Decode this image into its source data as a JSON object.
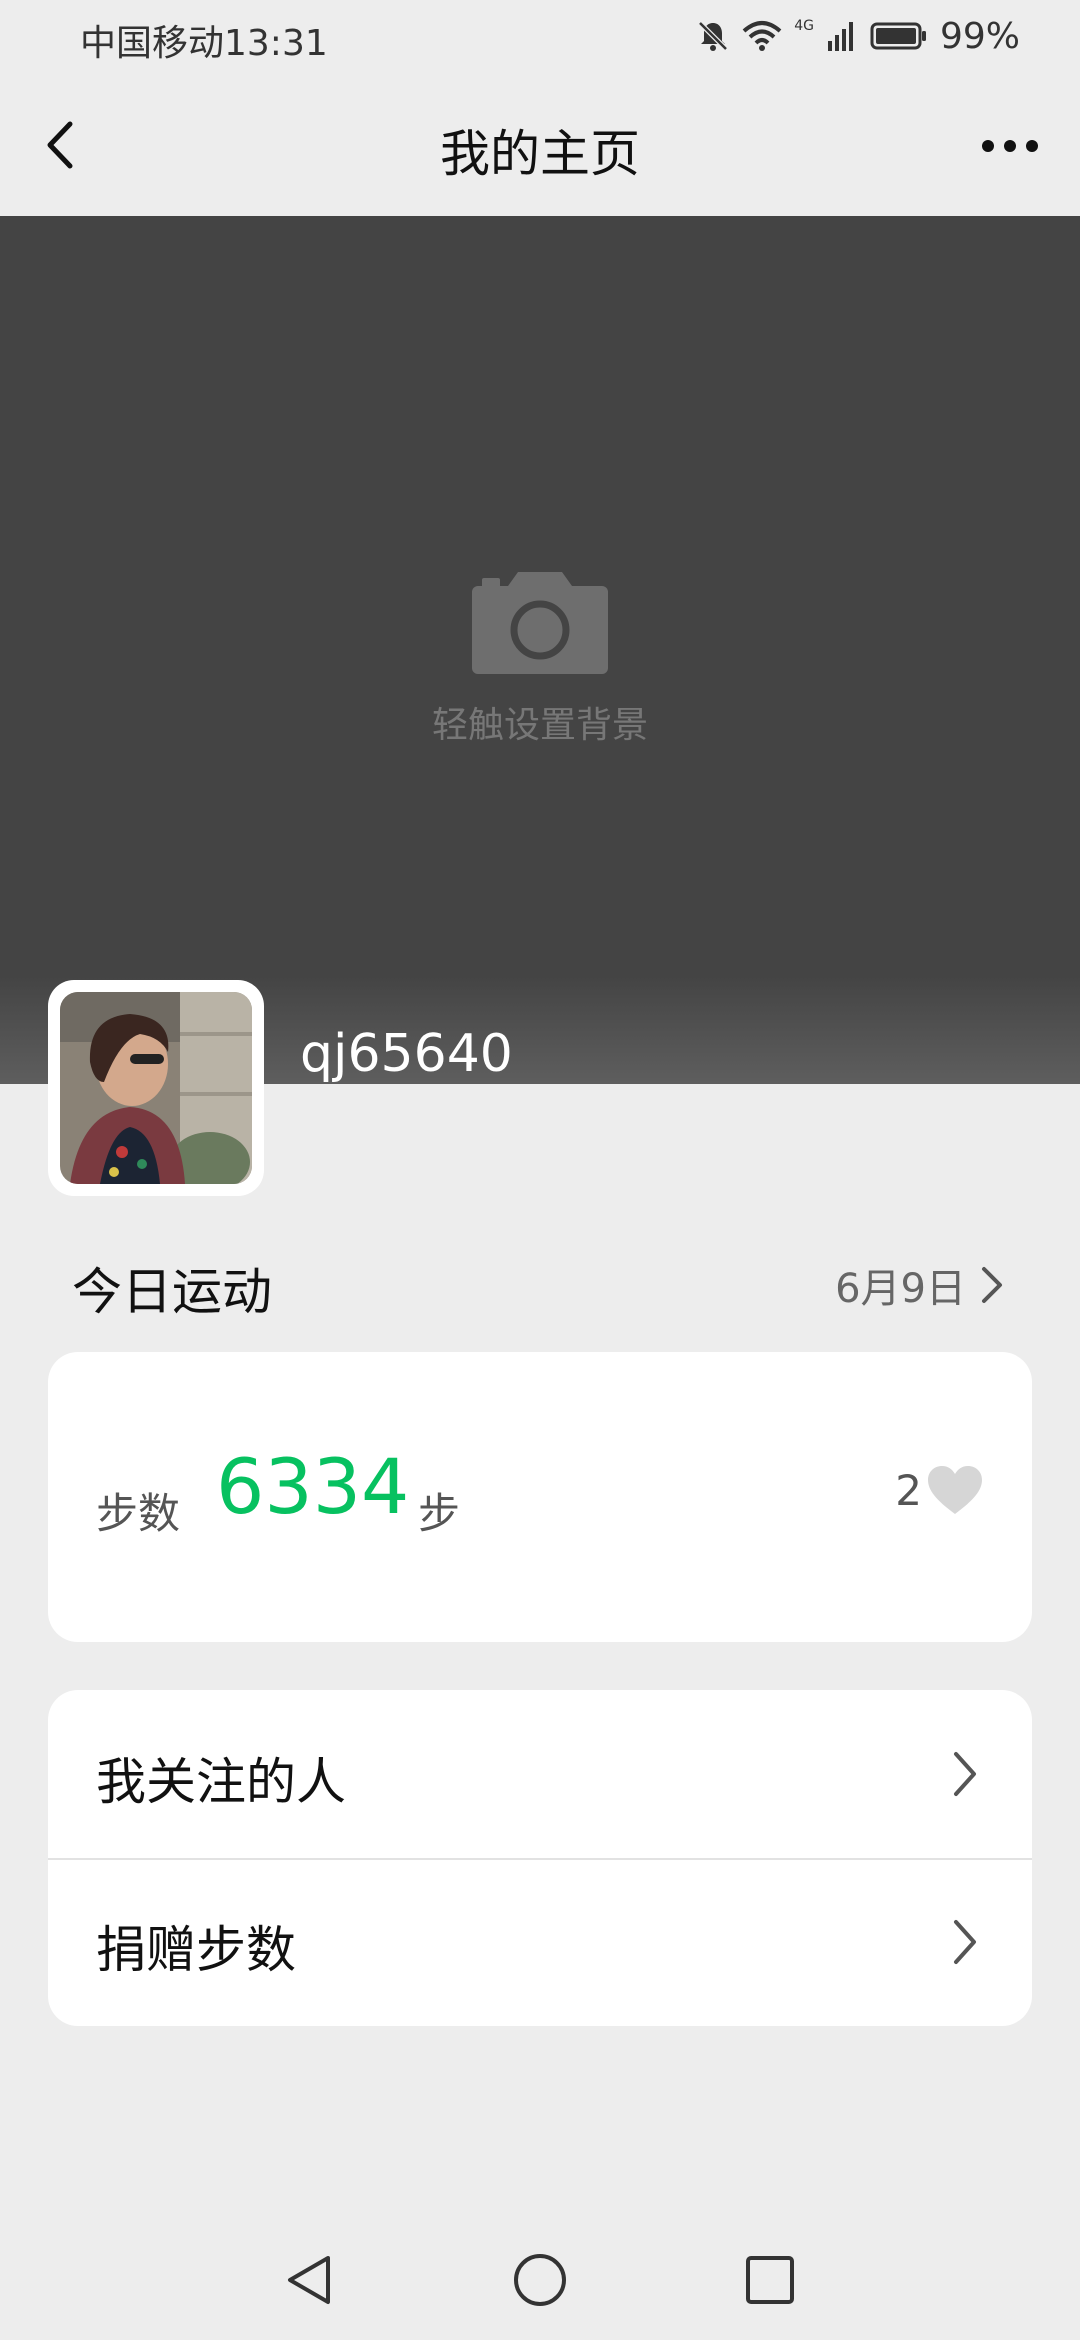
{
  "status_bar": {
    "carrier_time": "中国移动13:31",
    "network": "4G",
    "battery": "99%",
    "icons": [
      "bell-muted-icon",
      "wifi-icon",
      "signal-icon",
      "battery-icon"
    ]
  },
  "header": {
    "title": "我的主页",
    "back_icon": "chevron-left-icon",
    "more_icon": "more-dots-icon"
  },
  "cover": {
    "hint": "轻触设置背景",
    "icon": "camera-icon"
  },
  "profile": {
    "username": "qj65640"
  },
  "today": {
    "label": "今日运动",
    "date": "6月9日"
  },
  "steps": {
    "label": "步数",
    "value": "6334",
    "unit": "步",
    "likes": "2",
    "accent_color": "#07c160"
  },
  "menu": {
    "items": [
      {
        "label": "我关注的人"
      },
      {
        "label": "捐赠步数"
      }
    ]
  },
  "nav": {
    "icons": [
      "back-triangle-icon",
      "home-circle-icon",
      "recents-square-icon"
    ]
  }
}
